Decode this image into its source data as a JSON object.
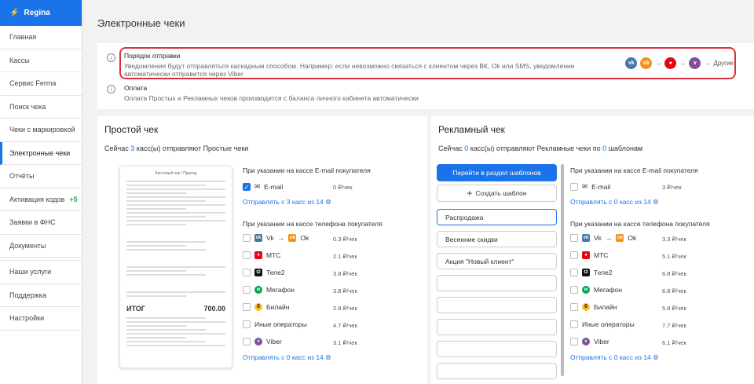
{
  "sidebar": {
    "brand": "Regina",
    "items": [
      "Главная",
      "Кассы",
      "Сервис Ferma",
      "Поиск чека",
      "Чеки с маркировкой",
      "Электронные чеки",
      "Отчёты",
      "Активация кодов",
      "Заявки в ФНС",
      "Документы",
      "Наши услуги",
      "Поддержка",
      "Настройки"
    ],
    "badge": "+5",
    "active": "Электронные чеки"
  },
  "page": {
    "title": "Электронные чеки"
  },
  "info": {
    "order_title": "Порядок отправки",
    "order_text1": "Уведомления будут отправляться каскадным способом. Например: если невозможно связаться с клиентом через ВК, Ok или SMS, уведомление",
    "order_text2": "автоматически отправится через Viber",
    "others": "Другие",
    "payment_title": "Оплата",
    "payment_text": "Оплата Простых и Рекламных чеков производится с баланса личного кабинета автоматически"
  },
  "simple": {
    "title": "Простой чек",
    "status_pre": "Сейчас",
    "count": "3",
    "status_post": "касс(ы) отправляют Простые чеки",
    "email_header": "При указании на кассе E-mail покупателя",
    "email_label": "E-mail",
    "email_price": "0 ₽/чек",
    "email_link": "Отправлять с 3 касс из 14",
    "phone_header": "При указании на кассе телефона покупателя",
    "operators": [
      {
        "name": "Vk",
        "name2": "Ok",
        "price": "0.3 ₽/чек"
      },
      {
        "name": "МТС",
        "price": "2.1 ₽/чек"
      },
      {
        "name": "Теле2",
        "price": "3.8 ₽/чек"
      },
      {
        "name": "Мегафон",
        "price": "3.8 ₽/чек"
      },
      {
        "name": "Билайн",
        "price": "2.8 ₽/чек"
      },
      {
        "name": "Иные операторы",
        "price": "4.7 ₽/чек"
      },
      {
        "name": "Viber",
        "price": "3.1 ₽/чек"
      }
    ],
    "phone_link": "Отправлять с 0 касс из 14"
  },
  "receipt": {
    "head": "Кассовый чек / Приход",
    "total_label": "ИТОГ",
    "total_value": "700.00"
  },
  "promo": {
    "title": "Рекламный чек",
    "status_pre": "Сейчас",
    "count": "0",
    "status_mid": "касс(ы) отправляют Рекламные чеки по",
    "count2": "0",
    "status_post": "шаблонам",
    "goto_btn": "Перейти в раздел шаблонов",
    "create_btn": "Создать шаблон",
    "templates": [
      "Распродажа",
      "Весенние скидки",
      "Акция \"Новый клиент\""
    ],
    "email_header": "При указании на кассе E-mail покупателя",
    "email_label": "E-mail",
    "email_price": "3 ₽/чек",
    "email_link": "Отправлять с 0 касс из 14",
    "phone_header": "При указании на кассе телефона покупателя",
    "operators": [
      {
        "name": "Vk",
        "name2": "Ok",
        "price": "3.3 ₽/чек"
      },
      {
        "name": "МТС",
        "price": "5.1 ₽/чек"
      },
      {
        "name": "Теле2",
        "price": "6.8 ₽/чек"
      },
      {
        "name": "Мегафон",
        "price": "6.8 ₽/чек"
      },
      {
        "name": "Билайн",
        "price": "5.8 ₽/чек"
      },
      {
        "name": "Иные операторы",
        "price": "7.7 ₽/чек"
      },
      {
        "name": "Viber",
        "price": "6.1 ₽/чек"
      }
    ],
    "phone_link": "Отправлять с 0 касс из 14"
  }
}
